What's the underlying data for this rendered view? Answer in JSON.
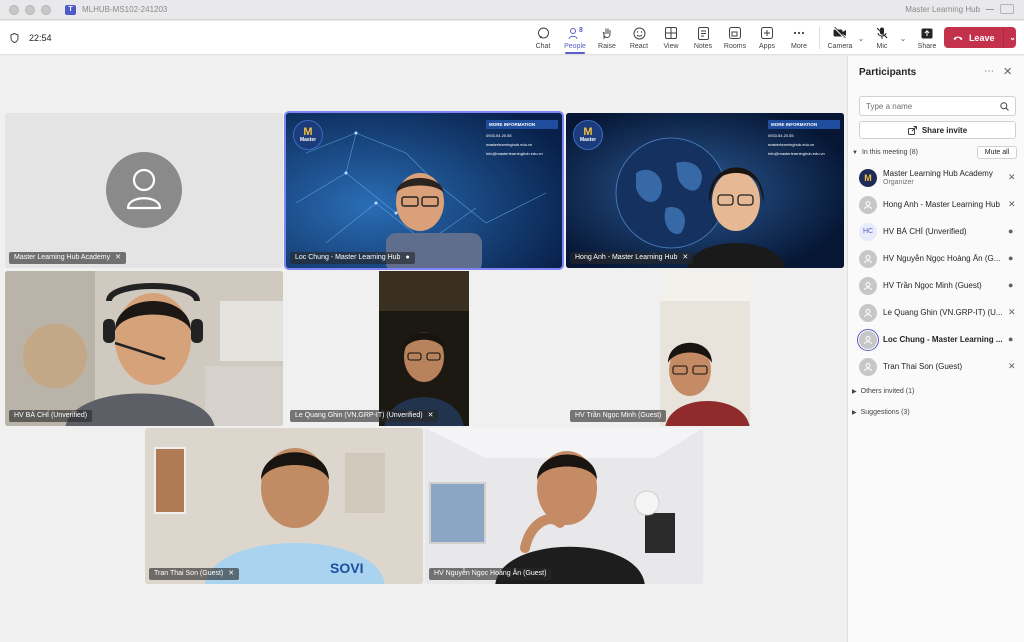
{
  "window": {
    "title": "MLHUB-MS102-241203",
    "org": "Master Learning Hub"
  },
  "toolbar": {
    "timer": "22:54",
    "buttons": [
      {
        "label": "Chat",
        "icon": "chat-icon"
      },
      {
        "label": "People",
        "icon": "people-icon",
        "count": "8",
        "active": true
      },
      {
        "label": "Raise",
        "icon": "raise-hand-icon"
      },
      {
        "label": "React",
        "icon": "react-icon"
      },
      {
        "label": "View",
        "icon": "view-icon"
      },
      {
        "label": "Notes",
        "icon": "notes-icon"
      },
      {
        "label": "Rooms",
        "icon": "rooms-icon"
      },
      {
        "label": "Apps",
        "icon": "apps-icon"
      },
      {
        "label": "More",
        "icon": "more-icon"
      }
    ],
    "camera_label": "Camera",
    "mic_label": "Mic",
    "share_label": "Share",
    "leave_label": "Leave"
  },
  "tiles": [
    {
      "label": "Master Learning Hub Academy"
    },
    {
      "label": "Loc Chung - Master Learning Hub"
    },
    {
      "label": "Hong Anh - Master Learning Hub"
    },
    {
      "label": "HV BÁ CHÍ (Unverified)"
    },
    {
      "label": "Le Quang Ghin (VN.GRP-IT) (Unverified)"
    },
    {
      "label": "HV Trần Ngọc Minh (Guest)"
    },
    {
      "label": "Tran Thai Son (Guest)"
    },
    {
      "label": "HV Nguyễn Ngọc Hoàng Ân (Guest)"
    }
  ],
  "slide": {
    "more_info": "MORE INFORMATION",
    "phone": "0933.54.20.55",
    "site": "masterlearninghub.edu.vn",
    "email": "info@masterlearninghub.edu.vn",
    "logo_text": "Master"
  },
  "panel": {
    "title": "Participants",
    "search_placeholder": "Type a name",
    "share_invite": "Share invite",
    "in_meeting": "In this meeting (8)",
    "mute_all": "Mute all",
    "participants": [
      {
        "name": "Master Learning Hub Academy",
        "role": "Organizer",
        "avatar": "org",
        "mic": "muted"
      },
      {
        "name": "Hong Anh - Master Learning Hub",
        "avatar": "person",
        "mic": "muted"
      },
      {
        "name": "HV BÁ CHÍ (Unverified)",
        "avatar": "initials",
        "initials": "HC",
        "mic": "on"
      },
      {
        "name": "HV Nguyễn Ngọc Hoàng Ân (G...",
        "avatar": "person",
        "mic": "on"
      },
      {
        "name": "HV Trần Ngọc Minh (Guest)",
        "avatar": "person",
        "mic": "on"
      },
      {
        "name": "Le Quang Ghin (VN.GRP-IT) (U...",
        "avatar": "person",
        "mic": "muted"
      },
      {
        "name": "Loc Chung - Master Learning ...",
        "avatar": "person",
        "mic": "on",
        "speaking": true
      },
      {
        "name": "Tran Thai Son (Guest)",
        "avatar": "person",
        "mic": "muted"
      }
    ],
    "others_invited": "Others invited (1)",
    "suggestions": "Suggestions (3)"
  }
}
